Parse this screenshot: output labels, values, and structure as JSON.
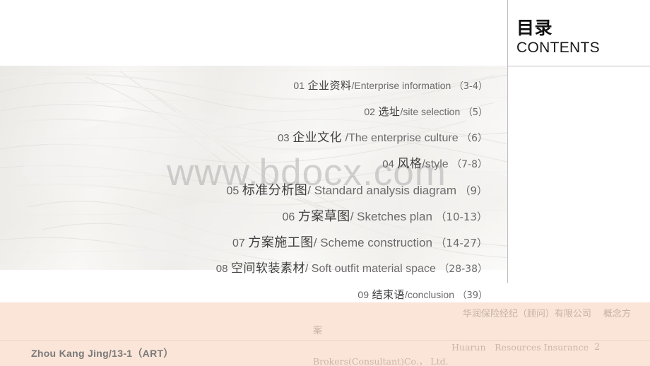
{
  "slide": {
    "title_cn": "目录",
    "title_en": "CONTENTS",
    "watermark": "www.bdocx.com"
  },
  "toc": {
    "items": [
      {
        "num": "01",
        "cn": "企业资料",
        "en": "/Enterprise information",
        "pages": "（3-4）"
      },
      {
        "num": "02",
        "cn": "选址",
        "en": "/site selection",
        "pages": "（5）"
      },
      {
        "num": "03",
        "cn": "企业文化",
        "en": "/The enterprise culture",
        "pages": "（6）"
      },
      {
        "num": "04",
        "cn": "风格",
        "en": "/style",
        "pages": "（7-8）"
      },
      {
        "num": "05",
        "cn": "标准分析图",
        "en": "/ Standard analysis diagram",
        "pages": "（9）"
      },
      {
        "num": "06",
        "cn": "方案草图",
        "en": "/ Sketches plan",
        "pages": "（10-13）"
      },
      {
        "num": "07",
        "cn": "方案施工图",
        "en": "/ Scheme construction",
        "pages": "（14-27）"
      },
      {
        "num": "08",
        "cn": "空间软装素材",
        "en": "/ Soft outfit material space",
        "pages": "（28-38）"
      },
      {
        "num": "09",
        "cn": "结束语",
        "en": "/conclusion",
        "pages": "（39）"
      }
    ]
  },
  "footer": {
    "author": "Zhou Kang Jing/13-1（ART）",
    "company_cn_line1": "华润保险经纪（顾问）有限公司　 概念方",
    "company_cn_line2": "案",
    "company_en_line1": "Huarun　Resources Insurance",
    "company_en_line2": "Brokers(Consultant)Co.， Ltd.",
    "page_number": "2"
  },
  "colors": {
    "footer_background": "#fae5d8",
    "divider": "#bfbfbf",
    "toc_text": "#5a5a5a",
    "footer_text": "#c6b3a6"
  }
}
